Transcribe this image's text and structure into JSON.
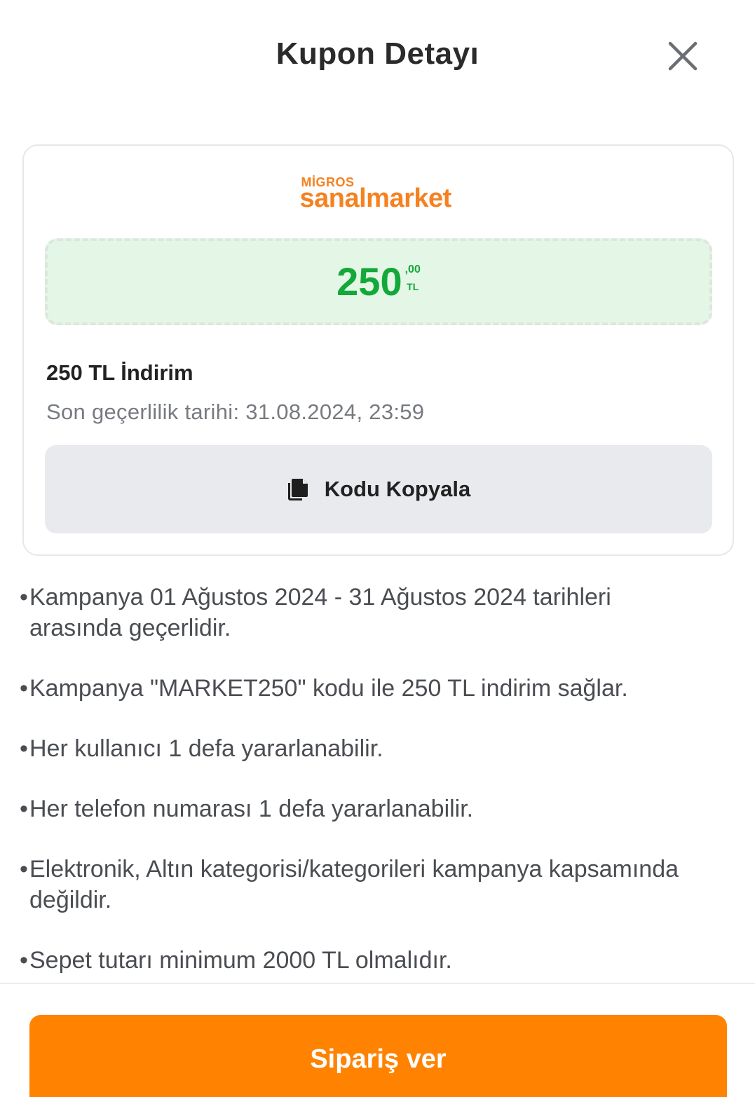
{
  "header": {
    "title": "Kupon Detayı",
    "close_icon": "close-icon"
  },
  "coupon": {
    "brand_top": "MİGROS",
    "brand_main": "sanalmarket",
    "amount_integer": "250",
    "amount_decimal": ",00",
    "amount_currency": "TL",
    "title": "250 TL İndirim",
    "expiry": "Son geçerlilik tarihi: 31.08.2024, 23:59",
    "copy_label": "Kodu Kopyala",
    "copy_icon": "copy-icon"
  },
  "terms": [
    "Kampanya 01 Ağustos 2024 - 31 Ağustos 2024 tarihleri arasında geçerlidir.",
    "Kampanya \"MARKET250\" kodu ile 250 TL indirim sağlar.",
    "Her kullanıcı 1 defa yararlanabilir.",
    "Her telefon numarası 1 defa yararlanabilir.",
    "Elektronik, Altın kategorisi/kategorileri kampanya kapsamında değildir.",
    "Sepet tutarı minimum 2000 TL olmalıdır."
  ],
  "footer": {
    "order_label": "Sipariş ver"
  },
  "colors": {
    "accent": "#ff8200",
    "brand": "#f58220",
    "amount_green": "#14a83b",
    "amount_bg": "#e4f7e6"
  }
}
